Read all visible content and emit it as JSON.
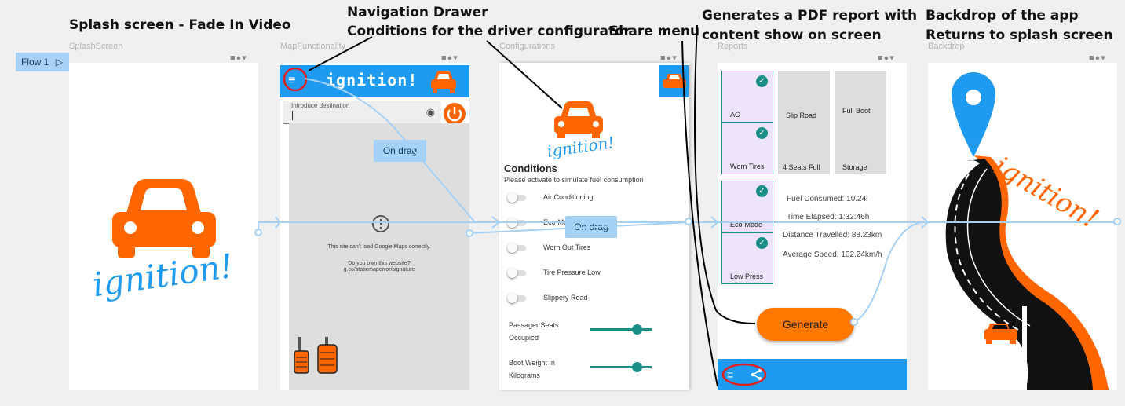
{
  "annotations": {
    "splash": "Splash screen - Fade In Video",
    "nav_line1": "Navigation Drawer",
    "nav_line2": "Conditions for the driver configurator",
    "share": "Share menu",
    "pdf_line1": "Generates a PDF report with",
    "pdf_line2": "content show on screen",
    "backdrop_line1": "Backdrop of the app",
    "backdrop_line2": "Returns to splash screen"
  },
  "frames": {
    "splash": "SplashScreen",
    "map": "MapFunctionality",
    "config": "Configurations",
    "reports": "Reports",
    "backdrop": "Backdrop"
  },
  "flow": {
    "label": "Flow 1"
  },
  "logo_text": "ignition!",
  "map": {
    "title": "ignition!",
    "destination_label": "Introduce destination",
    "drag_label": "On drag",
    "error_line": "This site can't load Google Maps correctly.",
    "own_line1": "Do you own this website?",
    "own_line2": "g.co/staticmaperror/signature"
  },
  "config": {
    "title": "Conditions",
    "subtitle": "Please activate to simulate fuel consumption",
    "toggles": [
      "Air Conditioning",
      "Eco-Mo",
      "Worn Out Tires",
      "Tire Pressure Low",
      "Slippery Road"
    ],
    "drag_label": "On drag",
    "seats_line1": "Passager Seats",
    "seats_line2": "Occupied",
    "boot_line1": "Boot Weight In",
    "boot_line2": "Kilograms",
    "seats_value": 0.8,
    "boot_value": 0.8
  },
  "reports": {
    "tiles": [
      {
        "label": "AC",
        "selected": true
      },
      {
        "label": "Slip Road",
        "selected": false
      },
      {
        "label": "Full Boot",
        "selected": false
      },
      {
        "label": "Worn Tires",
        "selected": true
      },
      {
        "label": "4 Seats Full",
        "selected": false
      },
      {
        "label": "Storage",
        "selected": false
      },
      {
        "label": "Eco-Mode",
        "selected": true
      },
      {
        "label": "Low Press",
        "selected": true
      }
    ],
    "stats": [
      "Fuel Consumed: 10.24l",
      "Time Elapsed: 1:32:46h",
      "Distance Travelled: 88.23km",
      "Average Speed: 102.24km/h"
    ],
    "generate": "Generate"
  },
  "colors": {
    "brand_blue": "#1e9bf0",
    "brand_orange": "#ff6600",
    "accent_teal": "#1a8f88",
    "flow_line": "#a5d1f6"
  }
}
